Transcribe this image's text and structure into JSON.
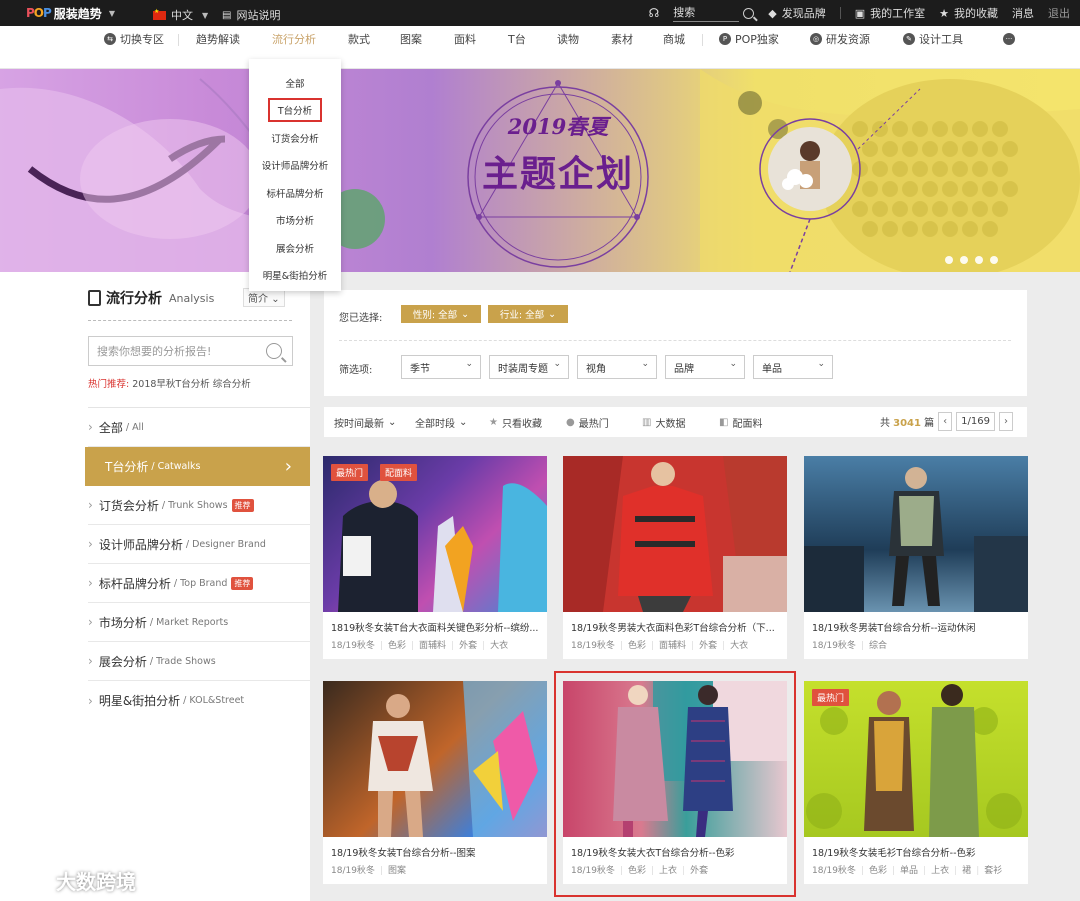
{
  "topbar": {
    "logo_pop": [
      "P",
      "O",
      "P"
    ],
    "logo_cn": "服装趋势",
    "lang": "中文",
    "site_help": "网站说明",
    "search_label": "搜索",
    "discover": "发现品牌",
    "workspace": "我的工作室",
    "favorites": "我的收藏",
    "messages": "消息",
    "logout": "退出"
  },
  "nav": {
    "items": [
      "切换专区",
      "趋势解读",
      "流行分析",
      "款式",
      "图案",
      "面料",
      "T台",
      "读物",
      "素材",
      "商城",
      "POP独家",
      "研发资源",
      "设计工具"
    ]
  },
  "banner": {
    "year": "2019春夏",
    "title": "主题企划"
  },
  "dropdown": {
    "items": [
      "全部",
      "T台分析",
      "订货会分析",
      "设计师品牌分析",
      "标杆品牌分析",
      "市场分析",
      "展会分析",
      "明星&街拍分析"
    ]
  },
  "sidebar": {
    "title": "流行分析",
    "title_en": "Analysis",
    "sort": "简介",
    "search_placeholder": "搜索你想要的分析报告!",
    "hot_label": "热门推荐:",
    "hot_1": "2018早秋T台分析",
    "hot_2": "综合分析",
    "menu": [
      {
        "cn": "全部",
        "en": "All"
      },
      {
        "cn": "T台分析",
        "en": "Catwalks"
      },
      {
        "cn": "订货会分析",
        "en": "Trunk Shows",
        "badge": "推荐"
      },
      {
        "cn": "设计师品牌分析",
        "en": "Designer Brand"
      },
      {
        "cn": "标杆品牌分析",
        "en": "Top Brand",
        "badge": "推荐"
      },
      {
        "cn": "市场分析",
        "en": "Market Reports"
      },
      {
        "cn": "展会分析",
        "en": "Trade Shows"
      },
      {
        "cn": "明星&街拍分析",
        "en": "KOL&Street"
      }
    ]
  },
  "filter": {
    "selected_label": "您已选择:",
    "chip_gender": "性别: 全部",
    "chip_industry": "行业: 全部",
    "filter_label": "筛选项:",
    "selects": [
      "季节",
      "时装周专题",
      "视角",
      "品牌",
      "单品"
    ]
  },
  "sortbar": {
    "by_time": "按时间最新",
    "all_time": "全部时段",
    "only_fav": "只看收藏",
    "hottest": "最热门",
    "big_data": "大数据",
    "fabrics": "配面料",
    "total_prefix": "共",
    "total": "3041",
    "total_suffix": "篇",
    "page": "1/169"
  },
  "cards": [
    {
      "caption": "1819秋冬女装T台大衣面料关键色彩分析--缤纷...",
      "tags": [
        "18/19秋冬",
        "色彩",
        "面辅料",
        "外套",
        "大衣"
      ],
      "hot": "最热门",
      "fab": "配面料"
    },
    {
      "caption": "18/19秋冬男装大衣面料色彩T台综合分析（下...",
      "tags": [
        "18/19秋冬",
        "色彩",
        "面辅料",
        "外套",
        "大衣"
      ]
    },
    {
      "caption": "18/19秋冬男装T台综合分析--运动休闲",
      "tags": [
        "18/19秋冬",
        "综合"
      ]
    },
    {
      "caption": "18/19秋冬女装T台综合分析--图案",
      "tags": [
        "18/19秋冬",
        "图案"
      ]
    },
    {
      "caption": "18/19秋冬女装大衣T台综合分析--色彩",
      "tags": [
        "18/19秋冬",
        "色彩",
        "上衣",
        "外套"
      ]
    },
    {
      "caption": "18/19秋冬女装毛衫T台综合分析--色彩",
      "tags": [
        "18/19秋冬",
        "色彩",
        "单品",
        "上衣",
        "裙",
        "套衫"
      ],
      "hot": "最热门"
    }
  ],
  "watermark": "大数跨境",
  "colors": {
    "gold": "#c9a24b",
    "red": "#d9332f",
    "banner_purple": "#6a1f8e"
  }
}
